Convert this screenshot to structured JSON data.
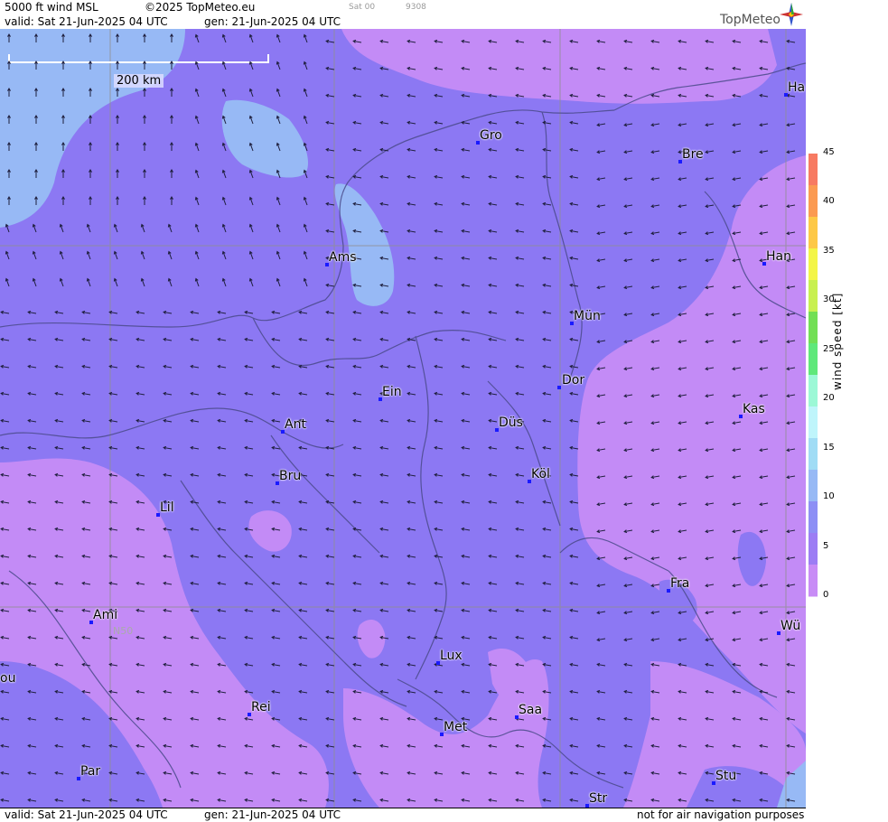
{
  "header": {
    "title": "5000 ft wind MSL",
    "copyright": "©2025 TopMeteo.eu",
    "slot": "Sat 00",
    "code": "9308",
    "valid": "valid:  Sat  21-Jun-2025  04 UTC",
    "generated": "gen: 21-Jun-2025 04 UTC",
    "brand": "TopMeteo"
  },
  "footer": {
    "valid": "valid:  Sat  21-Jun-2025  04 UTC",
    "generated": "gen: 21-Jun-2025 04 UTC",
    "disclaimer": "not for air navigation purposes"
  },
  "scale": {
    "label": "200 km"
  },
  "grid_label": "N50",
  "legend": {
    "title": "wind speed [kt]",
    "ticks": [
      "45",
      "40",
      "35",
      "30",
      "25",
      "20",
      "15",
      "10",
      "5",
      "0"
    ],
    "colors": [
      "#f77a62",
      "#fb9a52",
      "#fdc847",
      "#f3f547",
      "#c8f050",
      "#72df55",
      "#5fe87a",
      "#9cf8d6",
      "#bff5fb",
      "#a0dcf5",
      "#97b9f5",
      "#8d8ff5",
      "#9c7df4",
      "#c88cf6"
    ]
  },
  "cities": [
    {
      "name": "Ha",
      "label": "Ha"
    },
    {
      "name": "Gro",
      "label": "Gro"
    },
    {
      "name": "Bre",
      "label": "Bre"
    },
    {
      "name": "Ams",
      "label": "Ams"
    },
    {
      "name": "Han",
      "label": "Han"
    },
    {
      "name": "Mun",
      "label": "Mün"
    },
    {
      "name": "Dor",
      "label": "Dor"
    },
    {
      "name": "Ein",
      "label": "Ein"
    },
    {
      "name": "Dus",
      "label": "Düs"
    },
    {
      "name": "Kas",
      "label": "Kas"
    },
    {
      "name": "Ant",
      "label": "Ant"
    },
    {
      "name": "Kol",
      "label": "Köl"
    },
    {
      "name": "Bru",
      "label": "Bru"
    },
    {
      "name": "Lil",
      "label": "Lil"
    },
    {
      "name": "Fra",
      "label": "Fra"
    },
    {
      "name": "Ami",
      "label": "Ami"
    },
    {
      "name": "Wur",
      "label": "Wü"
    },
    {
      "name": "Lux",
      "label": "Lux"
    },
    {
      "name": "Bou",
      "label": "ou"
    },
    {
      "name": "Rei",
      "label": "Rei"
    },
    {
      "name": "Saa",
      "label": "Saa"
    },
    {
      "name": "Met",
      "label": "Met"
    },
    {
      "name": "Par",
      "label": "Par"
    },
    {
      "name": "Stu",
      "label": "Stu"
    },
    {
      "name": "Str",
      "label": "Str"
    }
  ]
}
